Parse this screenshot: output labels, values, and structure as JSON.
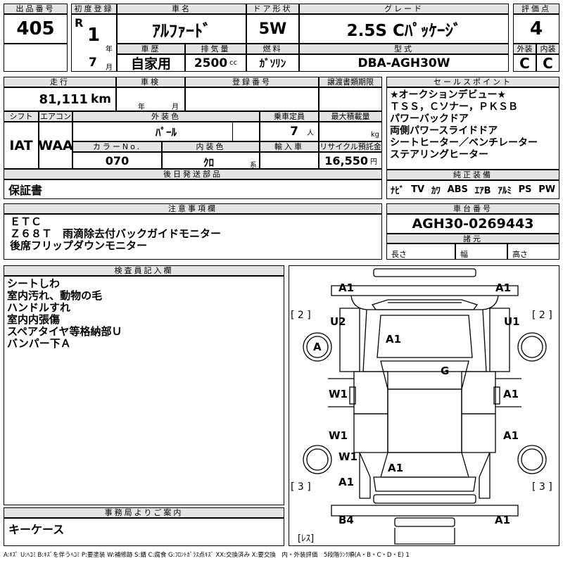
{
  "header": {
    "lot_no_label": "出品番号",
    "lot_no": "405",
    "first_reg_label": "初度登録",
    "era": "R",
    "year": "1",
    "year_unit": "年",
    "month": "7",
    "month_unit": "月",
    "car_name_label": "車名",
    "car_name": "ｱﾙﾌｧｰﾄﾞ",
    "door_label": "ドア形状",
    "door": "5W",
    "grade_label": "グレード",
    "grade": "2.5S Cﾊﾟｯｹｰｼﾞ",
    "score_label": "評価点",
    "score": "4",
    "history_label": "車歴",
    "history": "自家用",
    "displacement_label": "排気量",
    "displacement": "2500",
    "displacement_unit": "cc",
    "fuel_label": "燃料",
    "fuel": "ｶﾞｿﾘﾝ",
    "model_label": "型式",
    "model": "DBA-AGH30W",
    "ext_label": "外装",
    "ext": "C",
    "int_label": "内装",
    "int": "C"
  },
  "row2": {
    "mileage_label": "走行",
    "mileage": "81,111",
    "mileage_unit": "km",
    "inspection_label": "車検",
    "insp_year_unit": "年",
    "insp_month_unit": "月",
    "reg_no_label": "登録番号",
    "transfer_label": "譲渡書類期限",
    "shift_label": "シフト",
    "shift": "IAT",
    "ac_label": "エアコン",
    "ac": "WAA",
    "color_label": "外装色",
    "color": "ﾊﾟｰﾙ",
    "capacity_label": "乗車定員",
    "capacity": "7",
    "capacity_unit": "人",
    "load_label": "最大積載量",
    "load_unit": "kg",
    "color_no_label": "カラーNo.",
    "color_no": "070",
    "int_color_label": "内装色",
    "int_color": "ｸﾛ",
    "int_color_unit": "系",
    "import_label": "輸入車",
    "recycle_label": "リサイクル預託金",
    "recycle": "16,550",
    "recycle_unit": "円",
    "delivery_label": "後日発送部品",
    "delivery": "保証書"
  },
  "sales": {
    "label": "セールスポイント",
    "lines": "★オークションデビュー★\nＴＳＳ，Ｃソナー，ＰＫＳＢ\nパワーバックドア\n両側パワースライドドア\nシートヒーター／ベンチレーター\nステアリングヒーター"
  },
  "equipment": {
    "label": "純正装備",
    "items": [
      "ﾅﾋﾞ",
      "TV",
      "ｶﾜ",
      "ABS",
      "ｴｱB",
      "ｱﾙﾐ",
      "PS",
      "PW"
    ]
  },
  "notes": {
    "label": "注意事項欄",
    "lines": "ＥＴＣ\nＺ６８Ｔ　雨滴除去付バックガイドモニター\n後席フリップダウンモニター"
  },
  "chassis": {
    "label": "車台番号",
    "value": "AGH30-0269443",
    "specs_label": "諸元",
    "length_label": "長さ",
    "width_label": "幅",
    "height_label": "高さ"
  },
  "inspector": {
    "label": "検査員記入欄",
    "lines": "シートしわ\n室内汚れ、動物の毛\nハンドルすれ\n室内内張傷\nスペアタイヤ等格納部Ｕ\nバンパー下Ａ"
  },
  "office": {
    "label": "事務局よりご案内",
    "text": "キーケース"
  },
  "diagram": {
    "labels": [
      "A1",
      "A1",
      "U2",
      "U1",
      "A",
      "A1",
      "G",
      "W1",
      "A1",
      "W1",
      "A1",
      "W1",
      "A1",
      "A1",
      "B4",
      "A1"
    ],
    "corners": [
      "[ 2 ]",
      "[ 2 ]",
      "[ 3 ]",
      "[ 3 ]"
    ],
    "rear_label": "[ﾚｽ]"
  },
  "legend": "A:ｷｽﾞ U:ﾍｺﾐ B:ｷｽﾞを伴うﾍｺﾐ P:要塗装 W:補修跡 S:錆 C:腐食 G:ﾌﾛﾝﾄｶﾞﾗｽ点ｷｽﾞ XX:交換済み X:要交換　内・外装評価　5段階ﾗﾝｸ順(A・B・C・D・E) 1"
}
